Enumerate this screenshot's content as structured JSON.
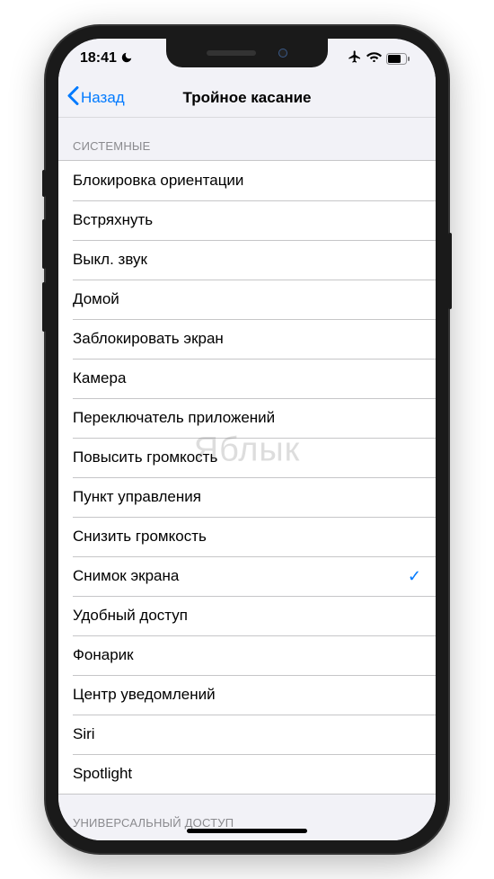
{
  "statusbar": {
    "time": "18:41"
  },
  "nav": {
    "back": "Назад",
    "title": "Тройное касание"
  },
  "sections": {
    "system_header": "СИСТЕМНЫЕ",
    "accessibility_header": "УНИВЕРСАЛЬНЫЙ ДОСТУП",
    "items": {
      "orientation_lock": "Блокировка ориентации",
      "shake": "Встряхнуть",
      "mute": "Выкл. звук",
      "home": "Домой",
      "lock_screen": "Заблокировать экран",
      "camera": "Камера",
      "app_switcher": "Переключатель приложений",
      "volume_up": "Повысить громкость",
      "control_center": "Пункт управления",
      "volume_down": "Снизить громкость",
      "screenshot": "Снимок экрана",
      "reachability": "Удобный доступ",
      "flashlight": "Фонарик",
      "notification_center": "Центр уведомлений",
      "siri": "Siri",
      "spotlight": "Spotlight"
    }
  },
  "selected": "screenshot",
  "watermark": "Яблык"
}
